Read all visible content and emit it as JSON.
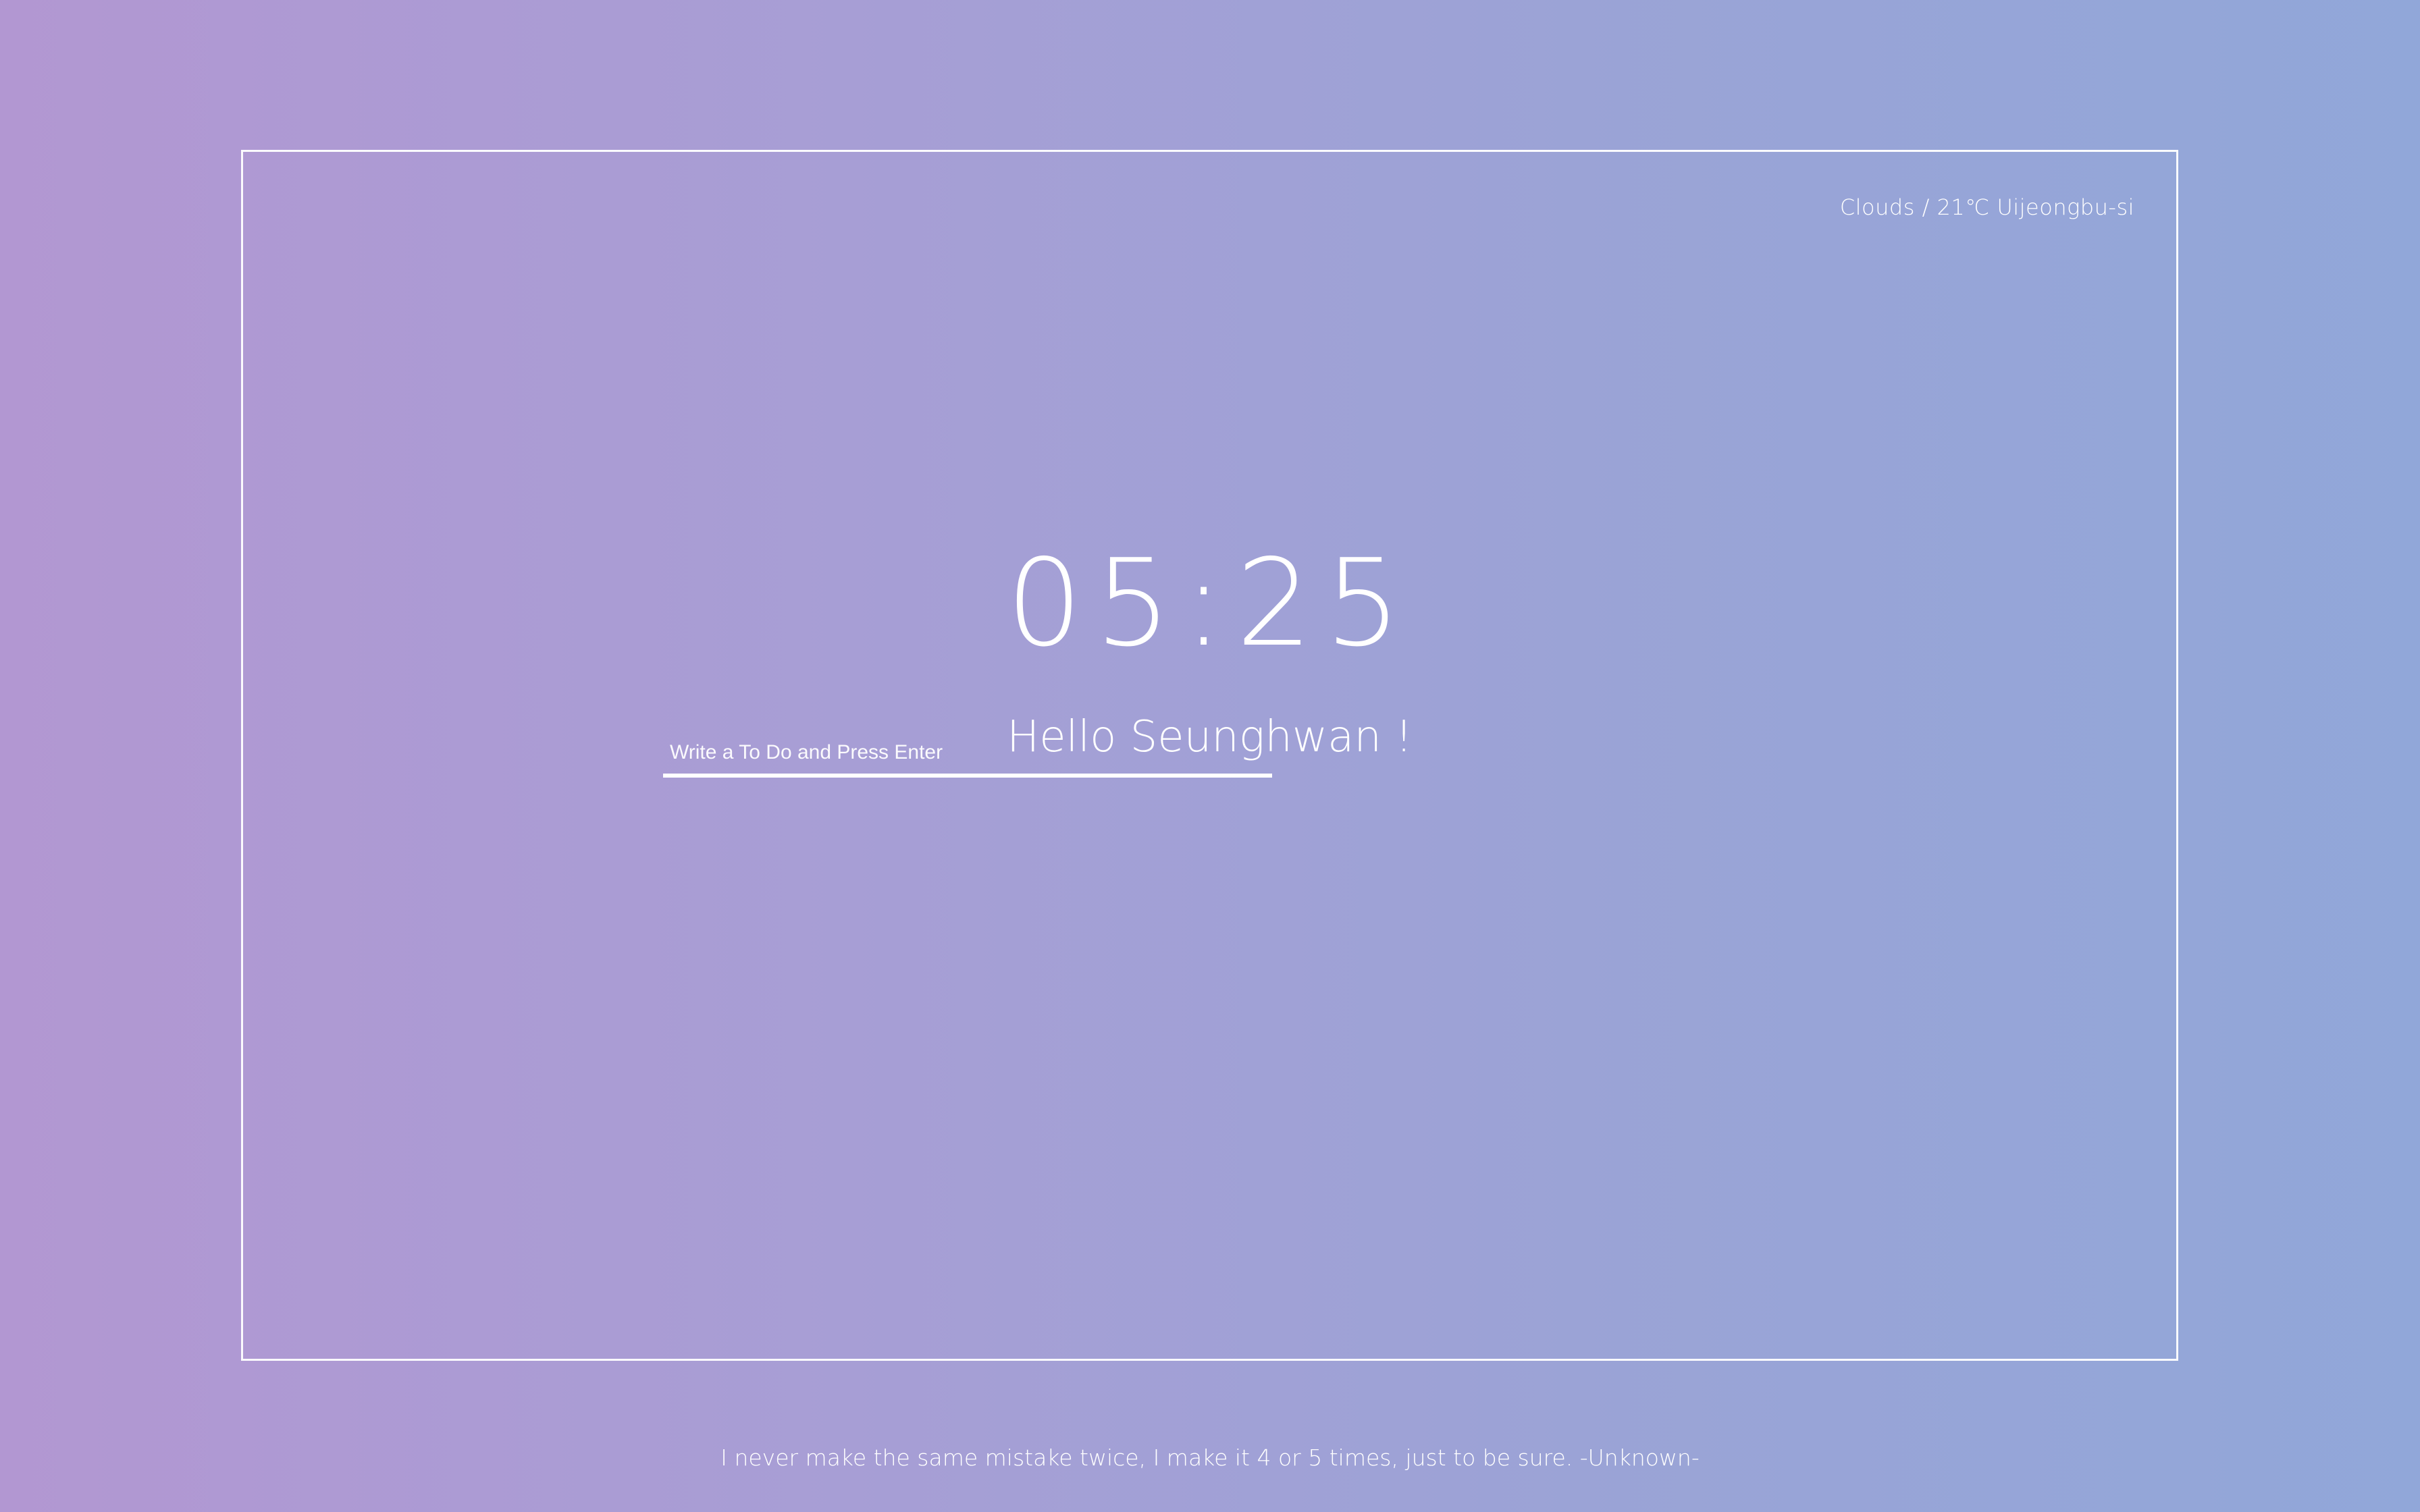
{
  "weather": {
    "text": "Clouds / 21℃ Uijeongbu-si"
  },
  "clock": {
    "time": "05:25"
  },
  "greeting": {
    "text": "Hello Seunghwan !"
  },
  "todo": {
    "placeholder": "Write a To Do and Press Enter",
    "value": ""
  },
  "quote": {
    "text": "I never make the same mistake twice, I make it 4 or 5 times, just to be sure. -Unknown-"
  },
  "colors": {
    "gradient_start": "#b297d2",
    "gradient_end": "#91a7d9",
    "text": "#ffffff"
  }
}
